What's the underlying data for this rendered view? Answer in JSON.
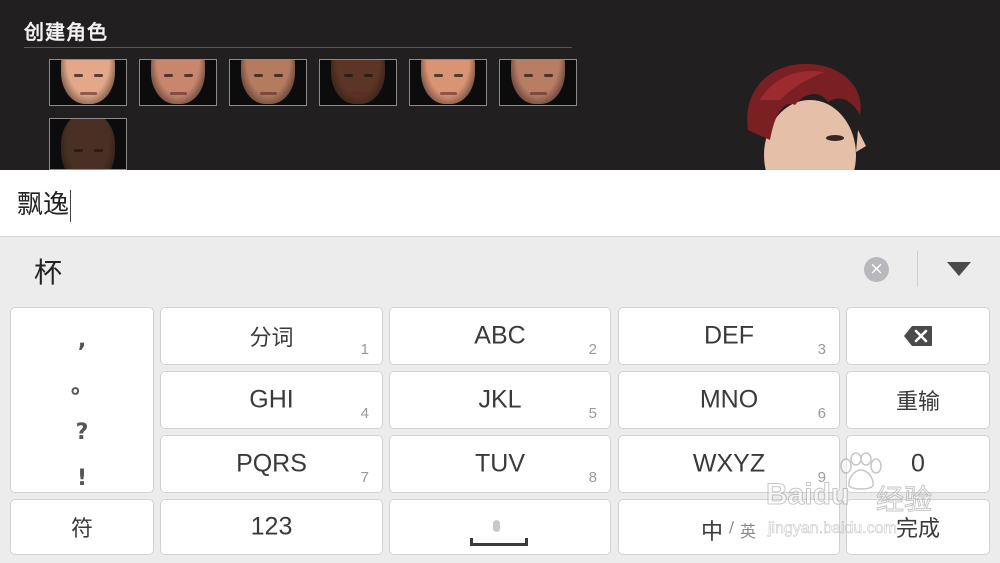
{
  "game": {
    "title": "创建角色",
    "faces": [
      {
        "skin": "#e2a889"
      },
      {
        "skin": "#c8876c"
      },
      {
        "skin": "#b57b60"
      },
      {
        "skin": "#5c3526"
      },
      {
        "skin": "#d99473"
      },
      {
        "skin": "#b97c64"
      },
      {
        "skin": "#4a3024"
      }
    ]
  },
  "input": {
    "text": "飘逸"
  },
  "candidates": {
    "first": "杯",
    "clear_icon": "×"
  },
  "keyboard": {
    "punct": [
      ",",
      "。",
      "?",
      "!"
    ],
    "keys": {
      "k1": {
        "label": "分词",
        "num": "1"
      },
      "k2": {
        "label": "ABC",
        "num": "2"
      },
      "k3": {
        "label": "DEF",
        "num": "3"
      },
      "k4": {
        "label": "GHI",
        "num": "4"
      },
      "k5": {
        "label": "JKL",
        "num": "5"
      },
      "k6": {
        "label": "MNO",
        "num": "6"
      },
      "k7": {
        "label": "PQRS",
        "num": "7"
      },
      "k8": {
        "label": "TUV",
        "num": "8"
      },
      "k9": {
        "label": "WXYZ",
        "num": "9"
      },
      "reenter": {
        "label": "重输"
      },
      "zero": {
        "label": "0"
      },
      "symbol": {
        "label": "符"
      },
      "numeric": {
        "label": "123"
      },
      "lang_zh": "中",
      "lang_sep": "/",
      "lang_en": "英",
      "done": {
        "label": "完成"
      }
    }
  },
  "watermark": {
    "brand": "Baidu",
    "cn": "经验",
    "url": "jingyan.baidu.com"
  },
  "colors": {
    "game_bg": "#221f20",
    "keyboard_bg": "#ececed",
    "key_bg": "#ffffff"
  }
}
